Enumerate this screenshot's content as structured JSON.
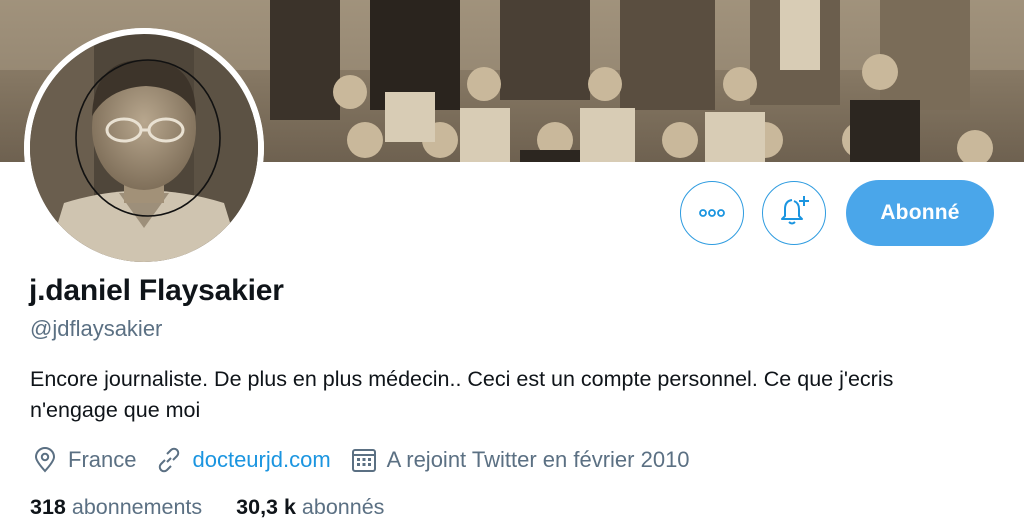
{
  "profile": {
    "display_name": "j.daniel Flaysakier",
    "handle": "@jdflaysakier",
    "bio": "Encore journaliste. De plus en plus médecin.. Ceci est un compte personnel. Ce que j'ecris n'engage que moi",
    "location": "France",
    "website": "docteurjd.com",
    "joined": "A rejoint Twitter en février 2010"
  },
  "actions": {
    "more_icon": "more-dots-icon",
    "notify_icon": "bell-plus-icon",
    "follow_label": "Abonné"
  },
  "stats": {
    "following_count": "318",
    "following_label": "abonnements",
    "followers_count": "30,3 k",
    "followers_label": "abonnés"
  },
  "icons": {
    "location": "map-pin-icon",
    "website": "link-icon",
    "joined": "calendar-icon"
  },
  "colors": {
    "accent": "#1b95e0",
    "follow_button_bg": "#4aa6ea",
    "secondary_text": "#5b7083",
    "primary_text": "#0f1419"
  }
}
